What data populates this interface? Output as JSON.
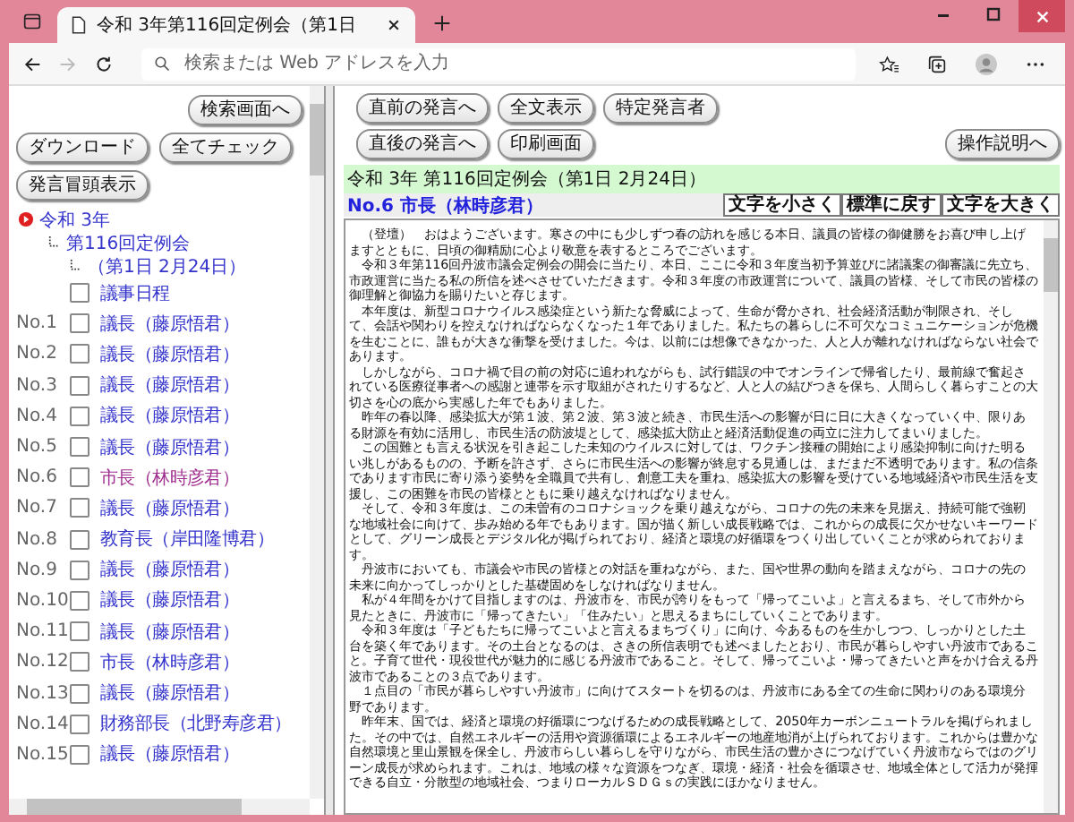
{
  "tab": {
    "title": "令和 3年第116回定例会（第1日"
  },
  "address_bar": {
    "placeholder": "検索または Web アドレスを入力"
  },
  "left_panel": {
    "search_button": "検索画面へ",
    "buttons": [
      "ダウンロード",
      "全てチェック"
    ],
    "opening_button": "発言冒頭表示",
    "tree": [
      {
        "label": "令和 3年",
        "children": [
          {
            "label": "第116回定例会",
            "children": [
              {
                "label": "（第1日 2月24日）"
              }
            ]
          }
        ]
      }
    ],
    "agenda": {
      "label": "議事日程",
      "checked": false
    },
    "speakers": [
      {
        "number": "No.1",
        "name": "議長（藤原悟君）",
        "checked": false,
        "visited": false
      },
      {
        "number": "No.2",
        "name": "議長（藤原悟君）",
        "checked": false,
        "visited": false
      },
      {
        "number": "No.3",
        "name": "議長（藤原悟君）",
        "checked": false,
        "visited": false
      },
      {
        "number": "No.4",
        "name": "議長（藤原悟君）",
        "checked": false,
        "visited": false
      },
      {
        "number": "No.5",
        "name": "議長（藤原悟君）",
        "checked": false,
        "visited": false
      },
      {
        "number": "No.6",
        "name": "市長（林時彦君）",
        "checked": false,
        "visited": true
      },
      {
        "number": "No.7",
        "name": "議長（藤原悟君）",
        "checked": false,
        "visited": false
      },
      {
        "number": "No.8",
        "name": "教育長（岸田隆博君）",
        "checked": false,
        "visited": false
      },
      {
        "number": "No.9",
        "name": "議長（藤原悟君）",
        "checked": false,
        "visited": false
      },
      {
        "number": "No.10",
        "name": "議長（藤原悟君）",
        "checked": false,
        "visited": false
      },
      {
        "number": "No.11",
        "name": "議長（藤原悟君）",
        "checked": false,
        "visited": false
      },
      {
        "number": "No.12",
        "name": "市長（林時彦君）",
        "checked": false,
        "visited": false
      },
      {
        "number": "No.13",
        "name": "議長（藤原悟君）",
        "checked": false,
        "visited": false
      },
      {
        "number": "No.14",
        "name": "財務部長（北野寿彦君）",
        "checked": false,
        "visited": false
      },
      {
        "number": "No.15",
        "name": "議長（藤原悟君）",
        "checked": false,
        "visited": false
      }
    ]
  },
  "right_panel": {
    "nav_buttons": [
      [
        "直前の発言へ",
        "全文表示",
        "特定発言者"
      ],
      [
        "直後の発言へ",
        "印刷画面"
      ]
    ],
    "help_button": "操作説明へ",
    "meeting_title": "令和 3年 第116回定例会（第1日 2月24日）",
    "speaker_heading": "No.6 市長（林時彦君）",
    "font_buttons": [
      "文字を小さく",
      "標準に戻す",
      "文字を大きく"
    ],
    "paragraphs": [
      "（登壇）　おはようございます。寒さの中にも少しずつ春の訪れを感じる本日、議員の皆様の御健勝をお喜び申し上げますとともに、日頃の御精励に心より敬意を表するところでございます。",
      "令和３年第116回丹波市議会定例会の開会に当たり、本日、ここに令和３年度当初予算並びに諸議案の御審議に先立ち、市政運営に当たる私の所信を述べさせていただきます。令和３年度の市政運営について、議員の皆様、そして市民の皆様の御理解と御協力を賜りたいと存じます。",
      "本年度は、新型コロナウイルス感染症という新たな脅威によって、生命が脅かされ、社会経済活動が制限され、そして、会話や関わりを控えなければならなくなった１年でありました。私たちの暮らしに不可欠なコミュニケーションが危機を生むことに、誰もが大きな衝撃を受けました。今は、以前には想像できなかった、人と人が離れなければならない社会であります。",
      "しかしながら、コロナ禍で目の前の対応に追われながらも、試行錯誤の中でオンラインで帰省したり、最前線で奮起されている医療従事者への感謝と連帯を示す取組がされたりするなど、人と人の結びつきを保ち、人間らしく暮らすことの大切さを心の底から実感した年でもありました。",
      "昨年の春以降、感染拡大が第１波、第２波、第３波と続き、市民生活への影響が日に日に大きくなっていく中、限りある財源を有効に活用し、市民生活の防波堤として、感染拡大防止と経済活動促進の両立に注力してまいりました。",
      "この国難とも言える状況を引き起こした未知のウイルスに対しては、ワクチン接種の開始により感染抑制に向けた明るい兆しがあるものの、予断を許さず、さらに市民生活への影響が終息する見通しは、まだまだ不透明であります。私の信条であります市民に寄り添う姿勢を全職員で共有し、創意工夫を重ね、感染拡大の影響を受けている地域経済や市民生活を支援し、この困難を市民の皆様とともに乗り越えなければなりません。",
      "そして、令和３年度は、この未曽有のコロナショックを乗り越えながら、コロナの先の未来を見据え、持続可能で強靭な地域社会に向けて、歩み始める年でもあります。国が描く新しい成長戦略では、これからの成長に欠かせないキーワードとして、グリーン成長とデジタル化が掲げられており、経済と環境の好循環をつくり出していくことが求められております。",
      "丹波市においても、市議会や市民の皆様との対話を重ねながら、また、国や世界の動向を踏まえながら、コロナの先の未来に向かってしっかりとした基礎固めをしなければなりません。",
      "私が４年間をかけて目指しますのは、丹波市を、市民が誇りをもって「帰ってこいよ」と言えるまち、そして市外から見たときに、丹波市に「帰ってきたい」「住みたい」と思えるまちにしていくことであります。",
      "令和３年度は「子どもたちに帰ってこいよと言えるまちづくり」に向け、今あるものを生かしつつ、しっかりとした土台を築く年であります。その土台となるのは、さきの所信表明でも述べましたとおり、市民が暮らしやすい丹波市であること。子育て世代・現役世代が魅力的に感じる丹波市であること。そして、帰ってこいよ・帰ってきたいと声をかけ合える丹波市であることの３点であります。",
      "１点目の「市民が暮らしやすい丹波市」に向けてスタートを切るのは、丹波市にある全ての生命に関わりのある環境分野であります。",
      "昨年末、国では、経済と環境の好循環につなげるための成長戦略として、2050年カーボンニュートラルを掲げられました。その中では、自然エネルギーの活用や資源循環によるエネルギーの地産地消が上げられております。これからは豊かな自然環境と里山景観を保全し、丹波市らしい暮らしを守りながら、市民生活の豊かさにつなげていく丹波市ならではのグリーン成長が求められます。これは、地域の様々な資源をつなぎ、環境・経済・社会を循環させ、地域全体として活力が発揮できる自立・分散型の地域社会、つまりローカルＳＤＧｓの実践にほかなりません。"
    ]
  }
}
